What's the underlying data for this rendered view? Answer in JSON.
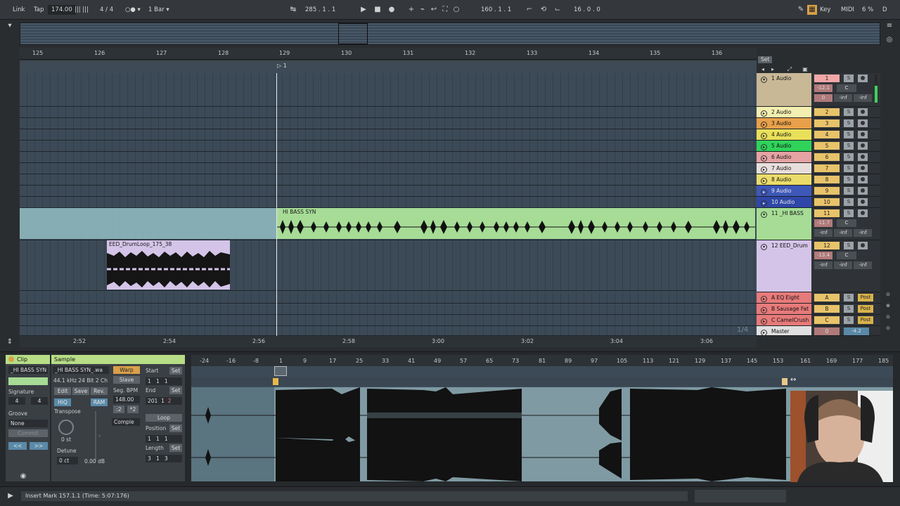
{
  "transport": {
    "link": "Link",
    "tap": "Tap",
    "tempo": "174.00",
    "sig_num": "4",
    "sig_den": "4",
    "quant": "1 Bar",
    "arrangement_position": "285 .  1 .  1",
    "loop_start": "160 .  1 .  1",
    "loop_length": "16 .  0 .  0",
    "key": "Key",
    "midi": "MIDI",
    "cpu": "6 %",
    "d": "D"
  },
  "beat_ruler": [
    "125",
    "126",
    "127",
    "128",
    "129",
    "130",
    "131",
    "132",
    "133",
    "134",
    "135",
    "136"
  ],
  "locator": "1",
  "time_ruler": [
    "2:52",
    "2:54",
    "2:56",
    "2:58",
    "3:00",
    "3:02",
    "3:04",
    "3:06"
  ],
  "grid_label": "1/4",
  "set_button": "Set",
  "clips": {
    "hi_bass": "HI BASS SYN",
    "drum": "EED_DrumLoop_175_38"
  },
  "tracks": [
    {
      "name": "1 Audio",
      "num": "1",
      "color": "#c8b896",
      "vol": "-12.1",
      "pan": "C",
      "send": "0",
      "inf1": "-inf",
      "inf2": "-inf"
    },
    {
      "name": "2 Audio",
      "num": "2",
      "color": "#f3efb0"
    },
    {
      "name": "3 Audio",
      "num": "3",
      "color": "#e8a04a"
    },
    {
      "name": "4 Audio",
      "num": "4",
      "color": "#e9e05a"
    },
    {
      "name": "5 Audio",
      "num": "5",
      "color": "#2fd35a"
    },
    {
      "name": "6 Audio",
      "num": "6",
      "color": "#e6a3a3"
    },
    {
      "name": "7 Audio",
      "num": "7",
      "color": "#e7dedc"
    },
    {
      "name": "8 Audio",
      "num": "8",
      "color": "#eadc6a"
    },
    {
      "name": "9 Audio",
      "num": "9",
      "color": "#3e58b8"
    },
    {
      "name": "10 Audio",
      "num": "10",
      "color": "#2f47a8"
    },
    {
      "name": "11 _HI BASS",
      "num": "11",
      "color": "#a6dc96",
      "vol": "-11.7",
      "pan": "C",
      "inf1": "-inf",
      "inf2": "-inf",
      "inf3": "-inf"
    },
    {
      "name": "12 EED_Drum",
      "num": "12",
      "color": "#d4c4e8",
      "vol": "-13.4",
      "pan": "C",
      "inf1": "-inf",
      "inf2": "-inf",
      "inf3": "-inf"
    }
  ],
  "returns": [
    {
      "name": "A EQ Eight",
      "num": "A",
      "color": "#e77a7a",
      "post": "Post"
    },
    {
      "name": "B Sausage Fat",
      "num": "B",
      "color": "#e77a7a",
      "post": "Post"
    },
    {
      "name": "C CamelCrush",
      "num": "C",
      "color": "#e77a7a",
      "post": "Post"
    }
  ],
  "master": {
    "name": "Master",
    "num": "0",
    "vol": "-4.2"
  },
  "solo": "S",
  "clip_panel": {
    "title": "Clip",
    "clip_name": "_HI BASS SYN",
    "signature_label": "Signature",
    "sig_num": "4",
    "sig_den": "4",
    "groove_label": "Groove",
    "groove_value": "None",
    "commit": "Commit"
  },
  "sample_panel": {
    "title": "Sample",
    "file": "_HI BASS SYN_.wa",
    "info": "44.1 kHz 24 Bit 2 Ch",
    "edit": "Edit",
    "save": "Save",
    "rev": "Rev.",
    "hiq": "HiQ",
    "ram": "RAM",
    "transpose_label": "Transpose",
    "transpose_value": "0 st",
    "detune_label": "Detune",
    "detune_value": "0 ct",
    "gain": "0.00 dB",
    "warp": "Warp",
    "slave": "Slave",
    "seg_bpm_label": "Seg. BPM",
    "seg_bpm": "148.00",
    "half": ":2",
    "double": "*2",
    "mode": "Comple",
    "start_label": "Start",
    "start": [
      "1",
      "1",
      "1"
    ],
    "end_label": "End",
    "end": [
      "201",
      "1",
      "2"
    ],
    "loop": "Loop",
    "position_label": "Position",
    "position": [
      "1",
      "1",
      "1"
    ],
    "length_label": "Length",
    "length": [
      "3",
      "1",
      "3"
    ],
    "set": "Set"
  },
  "wave_ruler": [
    "-24",
    "-16",
    "-8",
    "1",
    "9",
    "17",
    "25",
    "33",
    "41",
    "49",
    "57",
    "65",
    "73",
    "81",
    "89",
    "97",
    "105",
    "113",
    "121",
    "129",
    "137",
    "145",
    "153",
    "161",
    "169",
    "177",
    "185"
  ],
  "status": "Insert Mark 157.1.1 (Time: 5:07:176)"
}
